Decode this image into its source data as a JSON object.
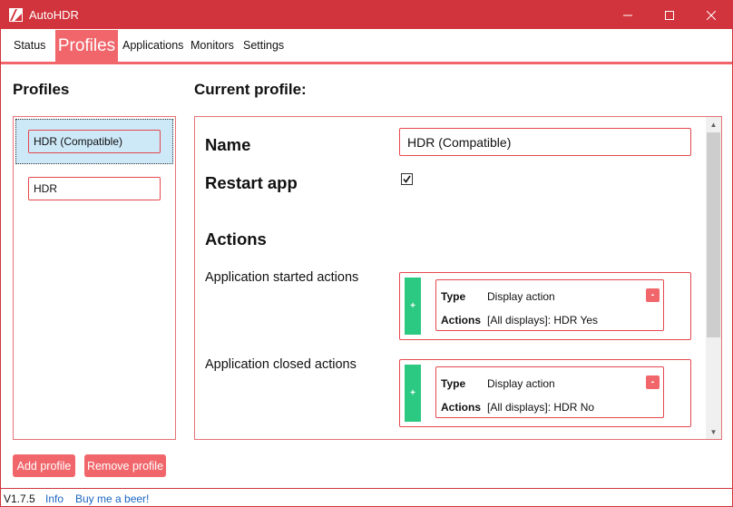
{
  "window": {
    "title": "AutoHDR",
    "accent_color": "#d1343c",
    "tab_active_color": "#f0666b",
    "add_button_color": "#2cc982"
  },
  "tabs": [
    "Status",
    "Profiles",
    "Applications",
    "Monitors",
    "Settings"
  ],
  "active_tab": "Profiles",
  "profiles_panel": {
    "heading": "Profiles",
    "items": [
      "HDR (Compatible)",
      "HDR"
    ],
    "selected": "HDR (Compatible)",
    "add_label": "Add profile",
    "remove_label": "Remove profile"
  },
  "current_profile": {
    "heading": "Current profile:",
    "name_label": "Name",
    "name_value": "HDR (Compatible)",
    "restart_label": "Restart app",
    "restart_checked": true,
    "actions_label": "Actions",
    "started": {
      "label": "Application started actions",
      "add_glyph": "+",
      "remove_glyph": "-",
      "type_key": "Type",
      "type_value": "Display action",
      "actions_key": "Actions",
      "actions_value": "[All displays]: HDR Yes"
    },
    "closed": {
      "label": "Application closed actions",
      "add_glyph": "+",
      "remove_glyph": "-",
      "type_key": "Type",
      "type_value": "Display action",
      "actions_key": "Actions",
      "actions_value": "[All displays]: HDR No"
    }
  },
  "statusbar": {
    "version": "V1.7.5",
    "info_link": "Info",
    "beer_link": "Buy me a beer!"
  }
}
